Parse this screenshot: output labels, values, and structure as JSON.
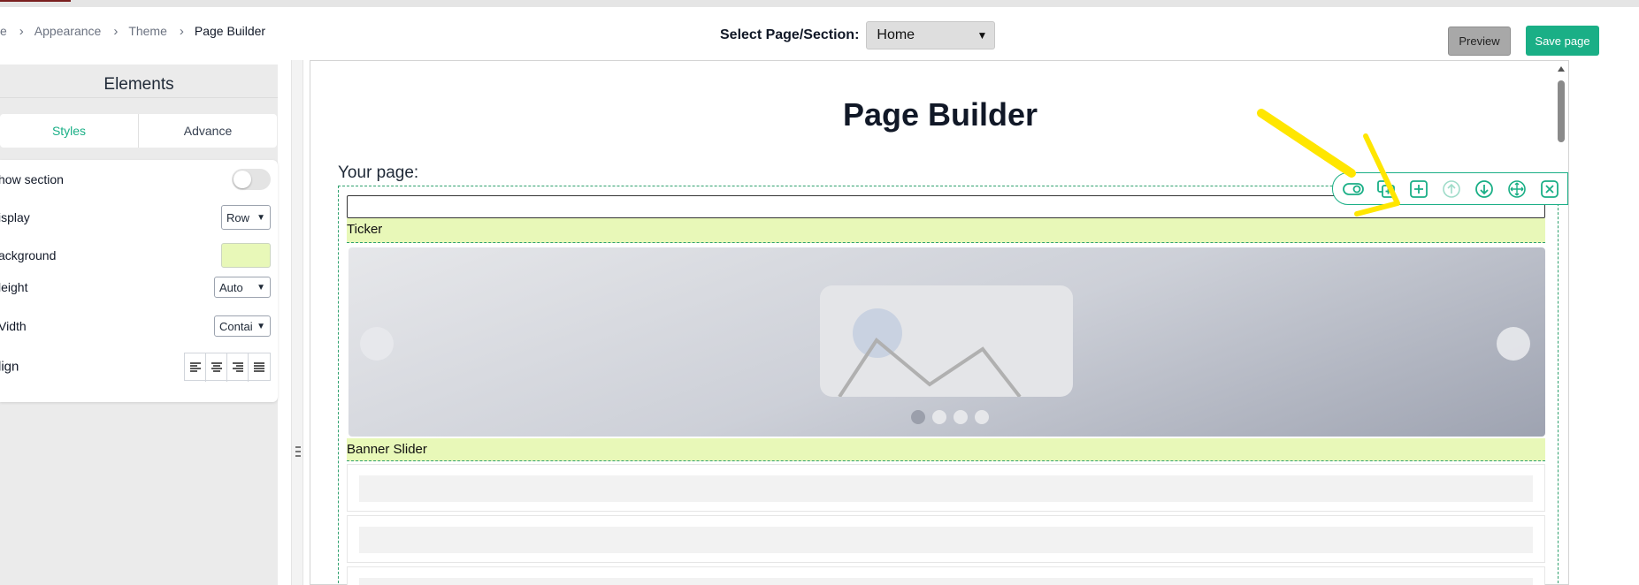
{
  "breadcrumb": {
    "items": [
      "e",
      "Appearance",
      "Theme",
      "Page Builder"
    ]
  },
  "page_select": {
    "label": "Select Page/Section:",
    "value": "Home"
  },
  "header_buttons": {
    "preview": "Preview",
    "save": "Save page"
  },
  "sidebar": {
    "title": "Elements",
    "tabs": [
      {
        "label": "Styles",
        "active": true
      },
      {
        "label": "Advance",
        "active": false
      }
    ],
    "props": {
      "show_section": {
        "label": "how section",
        "enabled": false
      },
      "display": {
        "label": "isplay",
        "value": "Row"
      },
      "background": {
        "label": "ackground",
        "color": "#e8f8b8"
      },
      "height": {
        "label": "leight",
        "value": "Auto"
      },
      "width": {
        "label": "Vidth",
        "value": "Contai"
      },
      "align": {
        "label": "lign",
        "icons": [
          "align-left-icon",
          "align-center-icon",
          "align-right-icon",
          "align-justify-icon"
        ]
      }
    }
  },
  "canvas": {
    "title": "Page Builder",
    "your_page_label": "Your page:",
    "sections": [
      {
        "label": "Ticker"
      },
      {
        "label": "Banner Slider",
        "slide_count": 4,
        "active_slide": 1
      }
    ]
  },
  "section_toolbar": {
    "icons": [
      "toggle-visibility-icon",
      "duplicate-icon",
      "add-icon",
      "move-up-icon",
      "move-down-icon",
      "drag-move-icon",
      "remove-icon"
    ]
  },
  "colors": {
    "accent": "#1aaf86",
    "section_highlight": "#e8f8b8",
    "annotation": "#ffe600"
  }
}
